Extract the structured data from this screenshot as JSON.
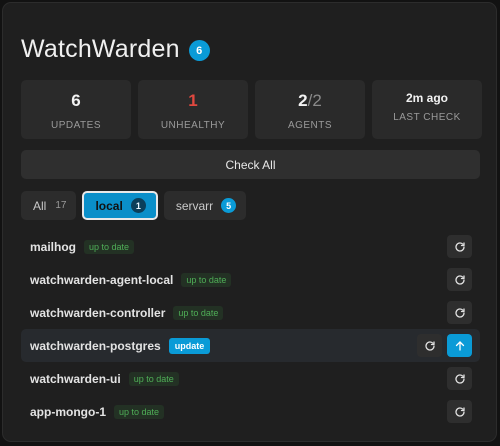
{
  "header": {
    "title": "WatchWarden",
    "badge": "6"
  },
  "stats": [
    {
      "value": "6",
      "label": "UPDATES"
    },
    {
      "value": "1",
      "label": "UNHEALTHY"
    },
    {
      "value_main": "2",
      "value_total": "/2",
      "label": "AGENTS"
    },
    {
      "value": "2m ago",
      "label": "LAST CHECK"
    }
  ],
  "check_all_label": "Check All",
  "tabs": [
    {
      "label": "All",
      "count": "17"
    },
    {
      "label": "local",
      "count": "1"
    },
    {
      "label": "servarr",
      "count": "5"
    }
  ],
  "containers": [
    {
      "name": "mailhog",
      "status": "up to date"
    },
    {
      "name": "watchwarden-agent-local",
      "status": "up to date"
    },
    {
      "name": "watchwarden-controller",
      "status": "up to date"
    },
    {
      "name": "watchwarden-postgres",
      "status": "update"
    },
    {
      "name": "watchwarden-ui",
      "status": "up to date"
    },
    {
      "name": "app-mongo-1",
      "status": "up to date"
    }
  ],
  "icons": {
    "refresh": "refresh-icon",
    "update": "arrow-up-icon"
  },
  "colors": {
    "accent": "#0a9bd7",
    "danger": "#e0483f",
    "ok": "#4fae57"
  }
}
